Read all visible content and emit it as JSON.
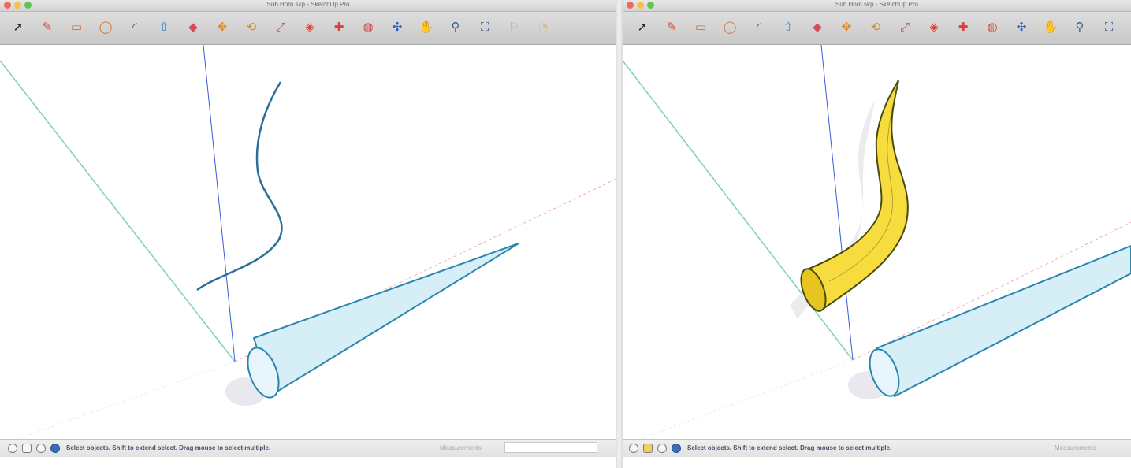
{
  "left_window": {
    "title": "Sub Horn.skp - SketchUp Pro",
    "toolbar_tools": [
      {
        "icon": "select-arrow-icon",
        "glyph": "➚",
        "color": "#222222"
      },
      {
        "icon": "eraser-icon",
        "glyph": "✎",
        "color": "#d9413a"
      },
      {
        "icon": "rectangle-icon",
        "glyph": "▭",
        "color": "#c7743a"
      },
      {
        "icon": "circle-icon",
        "glyph": "◯",
        "color": "#c7743a"
      },
      {
        "icon": "arc-icon",
        "glyph": "◜",
        "color": "#555555"
      },
      {
        "icon": "pushpull-icon",
        "glyph": "⇧",
        "color": "#3a86c7"
      },
      {
        "icon": "followme-icon",
        "glyph": "◆",
        "color": "#d94a5a"
      },
      {
        "icon": "move-icon",
        "glyph": "✥",
        "color": "#d98a2a"
      },
      {
        "icon": "rotate-icon",
        "glyph": "⟲",
        "color": "#d98a2a"
      },
      {
        "icon": "scale-icon",
        "glyph": "⤢",
        "color": "#d9413a"
      },
      {
        "icon": "offset-icon",
        "glyph": "◈",
        "color": "#d9413a"
      },
      {
        "icon": "tape-measure-icon",
        "glyph": "✚",
        "color": "#d9413a"
      },
      {
        "icon": "paint-bucket-icon",
        "glyph": "◍",
        "color": "#d9413a"
      },
      {
        "icon": "orbit-icon",
        "glyph": "✣",
        "color": "#2a62c7"
      },
      {
        "icon": "pan-hand-icon",
        "glyph": "✋",
        "color": "#e8c8a0"
      },
      {
        "icon": "zoom-icon",
        "glyph": "⚲",
        "color": "#3a5a8a"
      },
      {
        "icon": "zoom-extents-icon",
        "glyph": "⛶",
        "color": "#3a5a8a"
      },
      {
        "icon": "walk-icon",
        "glyph": "⚐",
        "color": "#9ab4d4"
      },
      {
        "icon": "look-around-icon",
        "glyph": "◔",
        "color": "#d8c090"
      }
    ],
    "status_hint": "Select objects. Shift to extend select. Drag mouse to select multiple.",
    "measurements_label": "Measurements"
  },
  "right_window": {
    "title": "Sub Horn.skp - SketchUp Pro",
    "toolbar_tools": [
      {
        "icon": "select-arrow-icon",
        "glyph": "➚",
        "color": "#222222"
      },
      {
        "icon": "eraser-icon",
        "glyph": "✎",
        "color": "#d9413a"
      },
      {
        "icon": "rectangle-icon",
        "glyph": "▭",
        "color": "#c7743a"
      },
      {
        "icon": "circle-icon",
        "glyph": "◯",
        "color": "#c7743a"
      },
      {
        "icon": "arc-icon",
        "glyph": "◜",
        "color": "#555555"
      },
      {
        "icon": "pushpull-icon",
        "glyph": "⇧",
        "color": "#3a86c7"
      },
      {
        "icon": "followme-icon",
        "glyph": "◆",
        "color": "#d94a5a"
      },
      {
        "icon": "move-icon",
        "glyph": "✥",
        "color": "#d98a2a"
      },
      {
        "icon": "rotate-icon",
        "glyph": "⟲",
        "color": "#d98a2a"
      },
      {
        "icon": "scale-icon",
        "glyph": "⤢",
        "color": "#d9413a"
      },
      {
        "icon": "offset-icon",
        "glyph": "◈",
        "color": "#d9413a"
      },
      {
        "icon": "tape-measure-icon",
        "glyph": "✚",
        "color": "#d9413a"
      },
      {
        "icon": "paint-bucket-icon",
        "glyph": "◍",
        "color": "#d9413a"
      },
      {
        "icon": "orbit-icon",
        "glyph": "✣",
        "color": "#2a62c7"
      },
      {
        "icon": "pan-hand-icon",
        "glyph": "✋",
        "color": "#e8c8a0"
      },
      {
        "icon": "zoom-icon",
        "glyph": "⚲",
        "color": "#3a5a8a"
      },
      {
        "icon": "zoom-extents-icon",
        "glyph": "⛶",
        "color": "#3a5a8a"
      }
    ],
    "status_hint": "Select objects. Shift to extend select. Drag mouse to select multiple.",
    "measurements_label": "Measurements"
  },
  "colors": {
    "blue_axis": "#3b5bdb",
    "green_axis": "#7fd3a8",
    "red_axis": "#f0a0a0",
    "cone_fill": "#d6eef6",
    "cone_stroke": "#2a86b0",
    "path_curve": "#2a6f9a",
    "horn_fill": "#f6dc3c",
    "horn_stroke": "#4a4a10"
  }
}
